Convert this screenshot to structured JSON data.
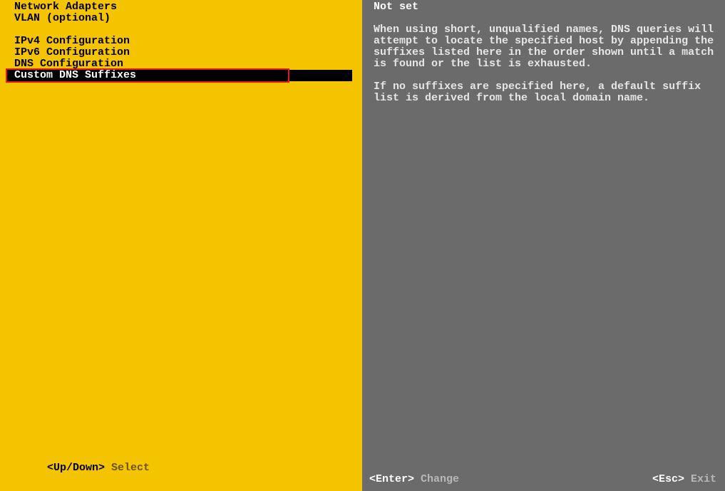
{
  "menu": {
    "top": [
      "Network Adapters",
      "VLAN (optional)"
    ],
    "sub": [
      "IPv4 Configuration",
      "IPv6 Configuration",
      "DNS Configuration",
      "Custom DNS Suffixes"
    ],
    "selected_index": 3
  },
  "right": {
    "status": "Not set",
    "paragraphs": [
      "When using short, unqualified names, DNS queries will attempt to locate the specified host by appending the suffixes listed here in the order shown until a match is found or the list is exhausted.",
      "If no suffixes are specified here, a default suffix list is derived from the local domain name."
    ]
  },
  "footer": {
    "left_key": "<Up/Down>",
    "left_action": "Select",
    "right_enter_key": "<Enter>",
    "right_enter_action": "Change",
    "right_esc_key": "<Esc>",
    "right_esc_action": "Exit"
  }
}
